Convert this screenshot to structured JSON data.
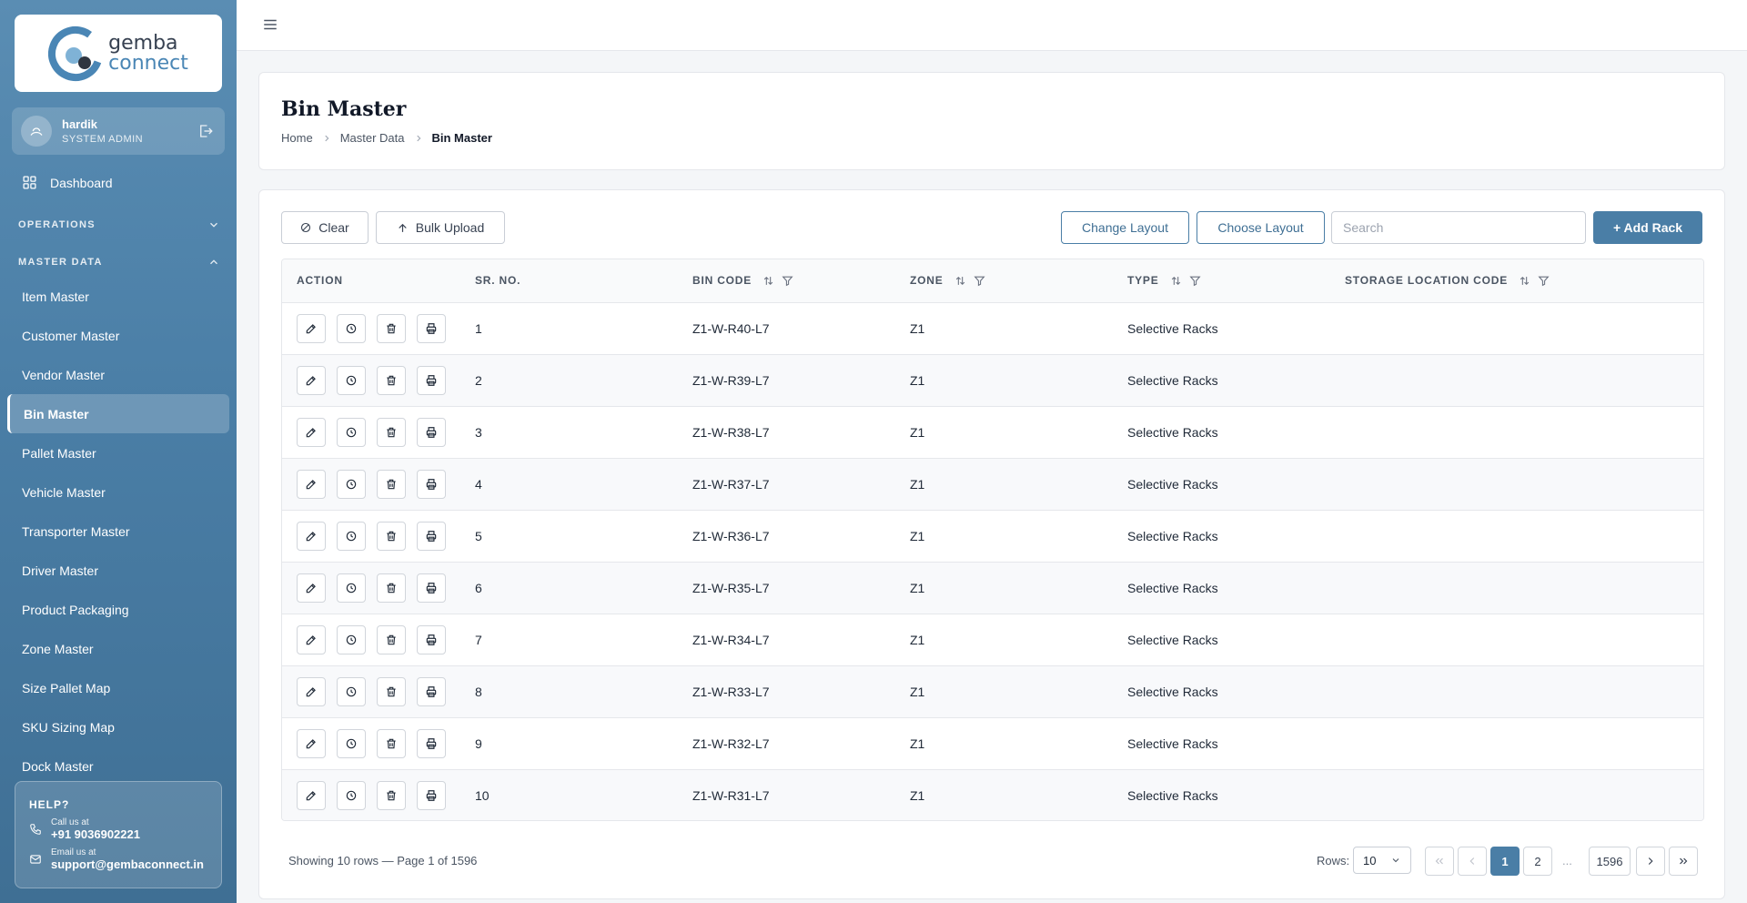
{
  "brand": {
    "line1": "gemba",
    "line2": "connect",
    "primary_color": "#4a7ea6"
  },
  "user": {
    "name": "hardik",
    "role": "SYSTEM ADMIN"
  },
  "nav": {
    "dashboard": "Dashboard",
    "operations": "OPERATIONS",
    "master_data": "MASTER DATA",
    "items": [
      {
        "label": "Item Master"
      },
      {
        "label": "Customer Master"
      },
      {
        "label": "Vendor Master"
      },
      {
        "label": "Bin Master",
        "active": true
      },
      {
        "label": "Pallet Master"
      },
      {
        "label": "Vehicle Master"
      },
      {
        "label": "Transporter Master"
      },
      {
        "label": "Driver Master"
      },
      {
        "label": "Product Packaging"
      },
      {
        "label": "Zone Master"
      },
      {
        "label": "Size Pallet Map"
      },
      {
        "label": "SKU Sizing Map"
      },
      {
        "label": "Dock Master"
      }
    ]
  },
  "help": {
    "title": "HELP?",
    "call_label": "Call us at",
    "phone": "+91 9036902221",
    "email_label": "Email us at",
    "email": "support@gembaconnect.in"
  },
  "page": {
    "title": "Bin Master",
    "breadcrumb": [
      "Home",
      "Master Data",
      "Bin Master"
    ]
  },
  "toolbar": {
    "clear": "Clear",
    "bulk_upload": "Bulk Upload",
    "change_layout": "Change Layout",
    "choose_layout": "Choose Layout",
    "search_placeholder": "Search",
    "add_rack": "+ Add Rack"
  },
  "table": {
    "columns": [
      "ACTION",
      "SR. NO.",
      "BIN CODE",
      "ZONE",
      "TYPE",
      "STORAGE LOCATION CODE"
    ],
    "rows": [
      {
        "sr": "1",
        "bin": "Z1-W-R40-L7",
        "zone": "Z1",
        "type": "Selective Racks",
        "slc": ""
      },
      {
        "sr": "2",
        "bin": "Z1-W-R39-L7",
        "zone": "Z1",
        "type": "Selective Racks",
        "slc": ""
      },
      {
        "sr": "3",
        "bin": "Z1-W-R38-L7",
        "zone": "Z1",
        "type": "Selective Racks",
        "slc": ""
      },
      {
        "sr": "4",
        "bin": "Z1-W-R37-L7",
        "zone": "Z1",
        "type": "Selective Racks",
        "slc": ""
      },
      {
        "sr": "5",
        "bin": "Z1-W-R36-L7",
        "zone": "Z1",
        "type": "Selective Racks",
        "slc": ""
      },
      {
        "sr": "6",
        "bin": "Z1-W-R35-L7",
        "zone": "Z1",
        "type": "Selective Racks",
        "slc": ""
      },
      {
        "sr": "7",
        "bin": "Z1-W-R34-L7",
        "zone": "Z1",
        "type": "Selective Racks",
        "slc": ""
      },
      {
        "sr": "8",
        "bin": "Z1-W-R33-L7",
        "zone": "Z1",
        "type": "Selective Racks",
        "slc": ""
      },
      {
        "sr": "9",
        "bin": "Z1-W-R32-L7",
        "zone": "Z1",
        "type": "Selective Racks",
        "slc": ""
      },
      {
        "sr": "10",
        "bin": "Z1-W-R31-L7",
        "zone": "Z1",
        "type": "Selective Racks",
        "slc": ""
      }
    ]
  },
  "footer": {
    "showing": "Showing 10 rows — Page 1 of 1596",
    "rows_label": "Rows:",
    "rows_value": "10",
    "pages": [
      "1",
      "2"
    ],
    "ellipsis": "...",
    "last_page": "1596"
  }
}
